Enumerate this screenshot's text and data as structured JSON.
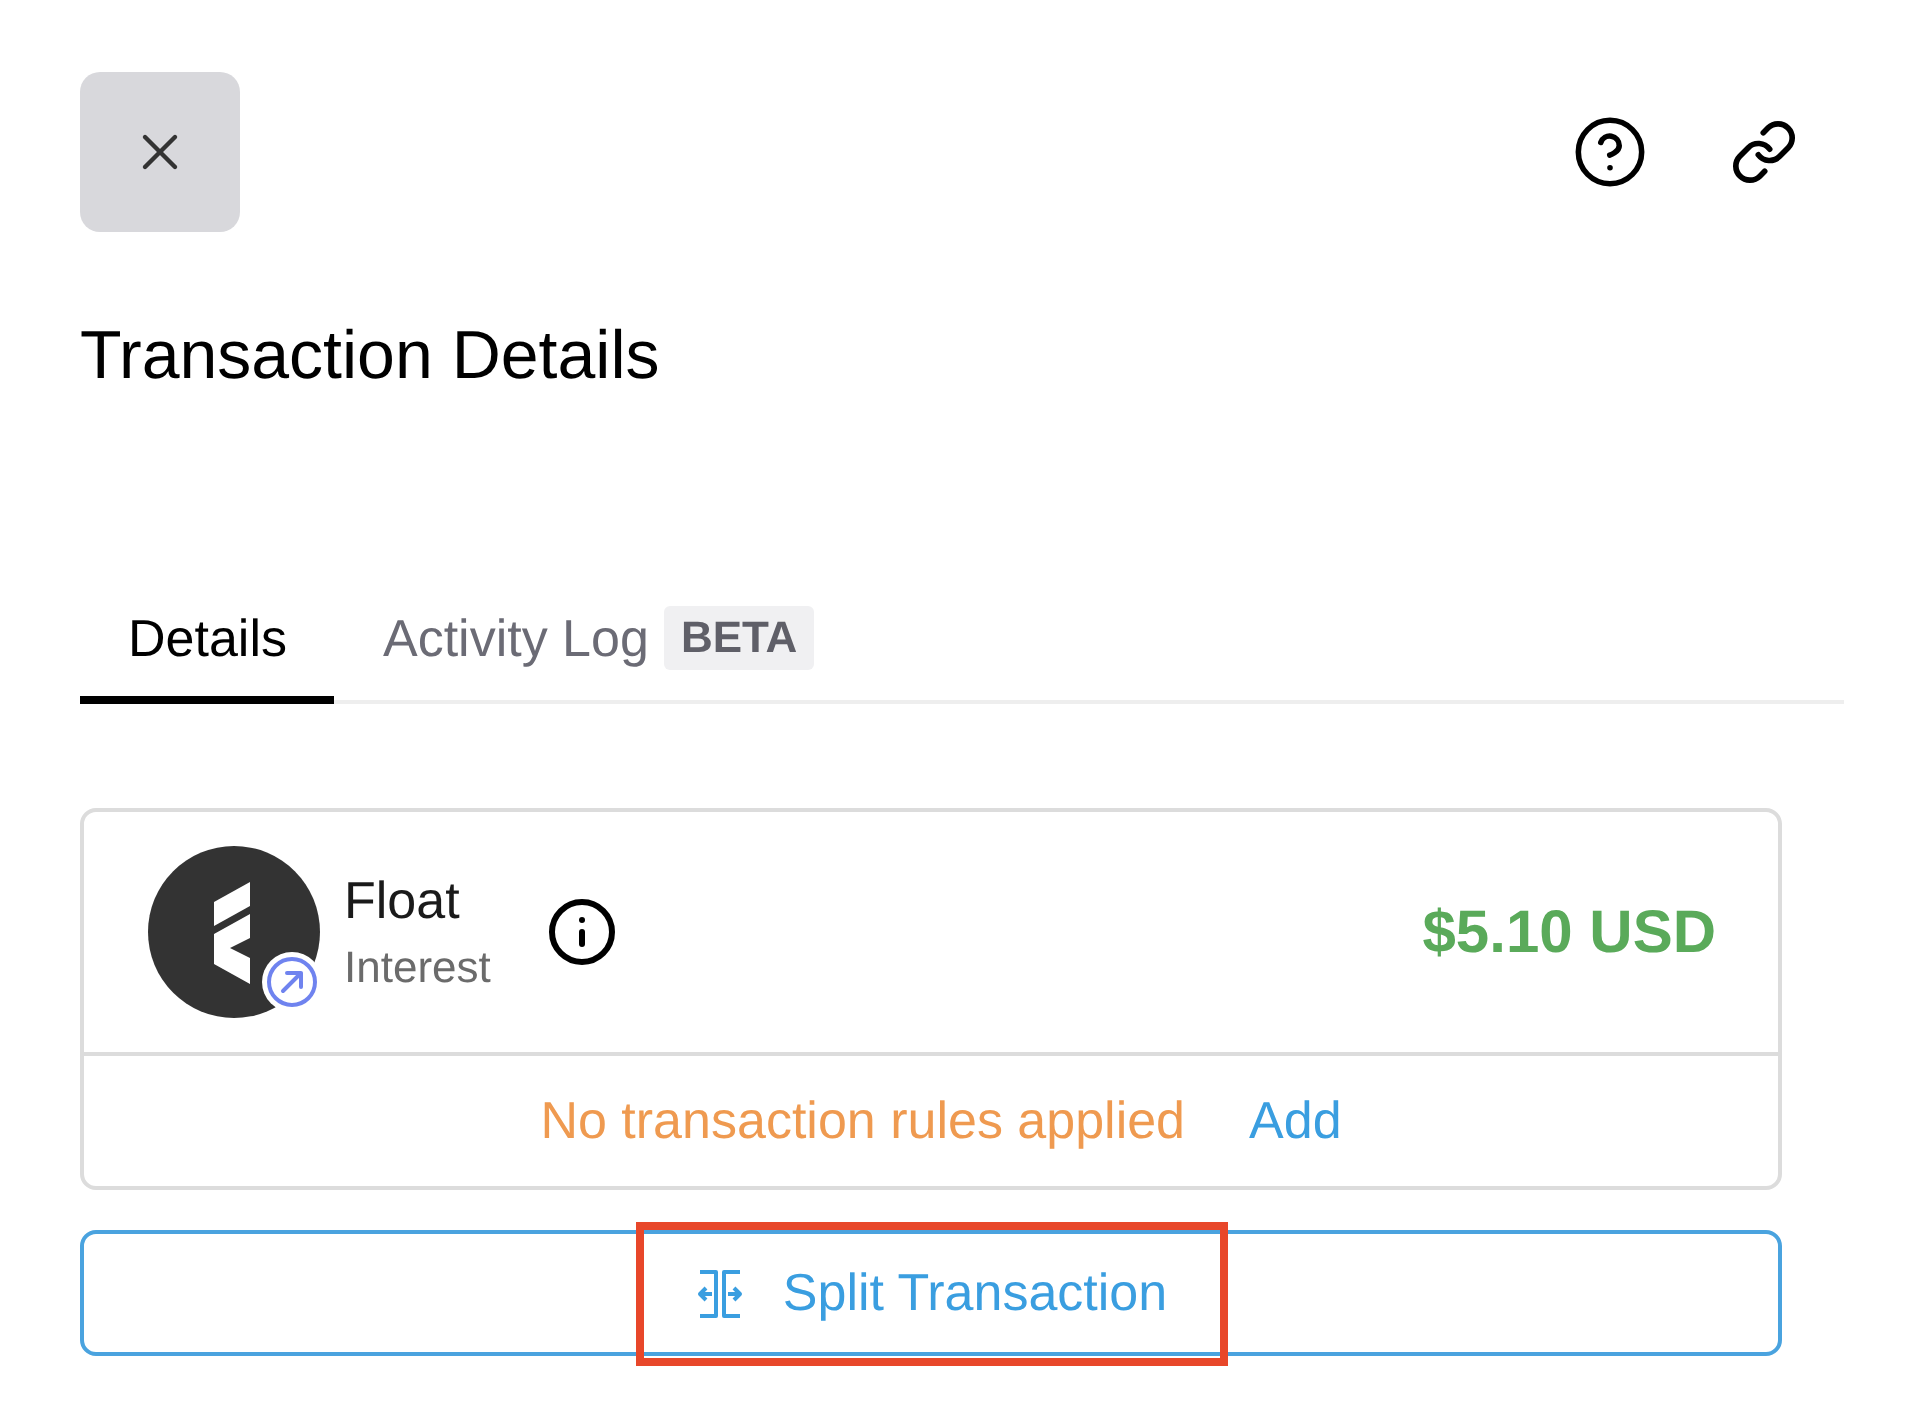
{
  "title": "Transaction Details",
  "tabs": [
    {
      "label": "Details",
      "selected": true
    },
    {
      "label": "Activity Log",
      "selected": false,
      "badge": "BETA"
    }
  ],
  "transaction": {
    "merchant": "Float",
    "category": "Interest",
    "amount": "$5.10 USD",
    "rules_status": "No transaction rules applied",
    "rules_action": "Add"
  },
  "split_button": {
    "label": "Split Transaction",
    "highlighted": true
  }
}
